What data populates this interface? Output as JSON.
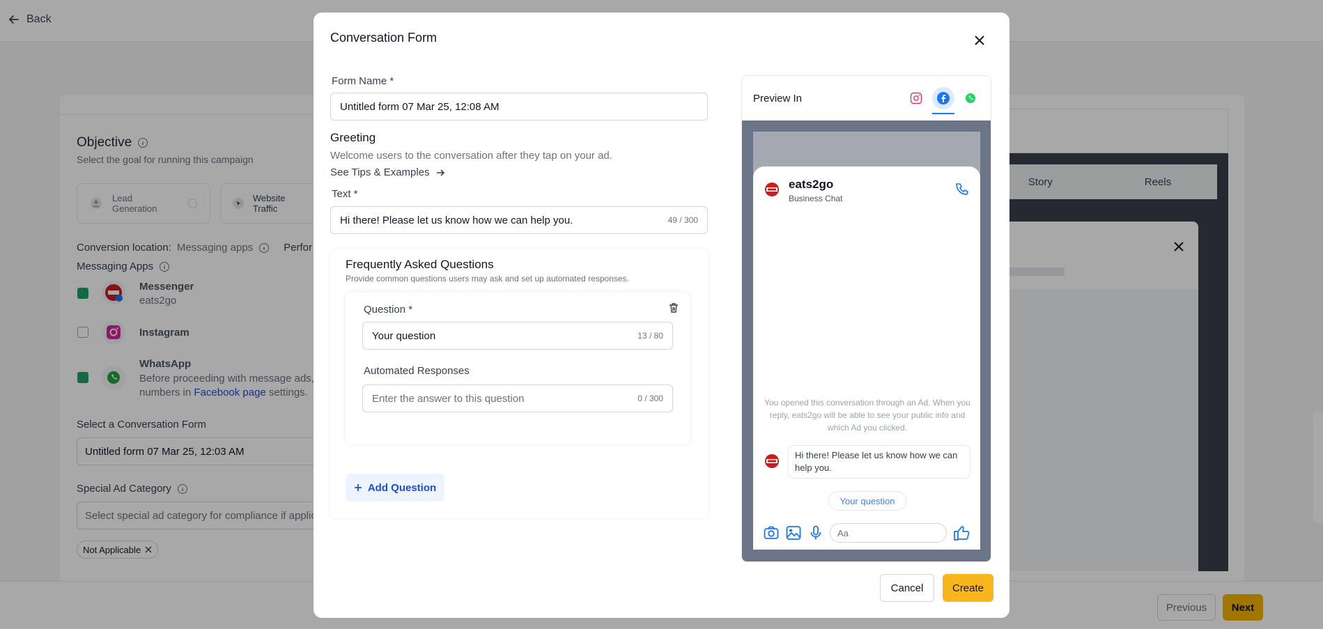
{
  "background": {
    "back_label": "Back",
    "objective_title": "Objective",
    "objective_subtitle": "Select the goal for running this campaign",
    "goal_lead": "Lead Generation",
    "goal_traffic": "Website Traffic",
    "conversion_location_label": "Conversion location:",
    "conversion_location_value": "Messaging apps",
    "performance_cut": "Perfor",
    "messaging_apps_label": "Messaging Apps",
    "apps": [
      {
        "name": "Messenger",
        "sub": "eats2go",
        "checked": true
      },
      {
        "name": "Instagram",
        "sub": "",
        "checked": false
      },
      {
        "name": "WhatsApp",
        "sub": "Before proceeding with message ads,",
        "checked": true
      }
    ],
    "whatsapp_line2_prefix": "numbers in",
    "whatsapp_link": "Facebook page",
    "whatsapp_line2_suffix": "settings.",
    "select_form_label": "Select a Conversation Form",
    "select_form_value": "Untitled form 07 Mar 25, 12:03 AM",
    "special_ad_label": "Special Ad Category",
    "special_ad_placeholder": "Select special ad category for compliance if applic",
    "not_applicable_chip": "Not Applicable",
    "story_tab": "Story",
    "reels_tab": "Reels",
    "previous_button": "Previous",
    "next_button": "Next"
  },
  "modal": {
    "title": "Conversation Form",
    "form_name_label": "Form Name *",
    "form_name_value": "Untitled form 07 Mar 25, 12:08 AM",
    "greeting_title": "Greeting",
    "greeting_desc": "Welcome users to the conversation after they tap on your ad.",
    "tips_link": "See Tips & Examples",
    "text_label": "Text *",
    "text_value": "Hi there! Please let us know how we can help you.",
    "text_counter": "49 / 300",
    "faq_title": "Frequently Asked Questions",
    "faq_desc": "Provide common questions users may ask and set up automated responses.",
    "question_label": "Question *",
    "question_value": "Your question",
    "question_counter": "13 / 80",
    "responses_label": "Automated Responses",
    "responses_placeholder": "Enter the answer to this question",
    "responses_counter": "0 / 300",
    "add_question": "Add Question",
    "cancel": "Cancel",
    "create": "Create"
  },
  "preview": {
    "title": "Preview In",
    "selected_platform": "facebook",
    "business_name": "eats2go",
    "business_sub": "Business Chat",
    "notice": "You opened this conversation through an Ad. When you reply, eats2go will be able to see your public info and which Ad you clicked.",
    "greeting_message": "Hi there! Please let us know how we can help you.",
    "question_chip": "Your question",
    "composer_placeholder": "Aa"
  },
  "colors": {
    "accent_yellow": "#f8b51c",
    "link_blue": "#1d4ed8",
    "messenger_blue": "#1877f2",
    "whatsapp_green": "#25d366",
    "check_green": "#22a06b"
  }
}
